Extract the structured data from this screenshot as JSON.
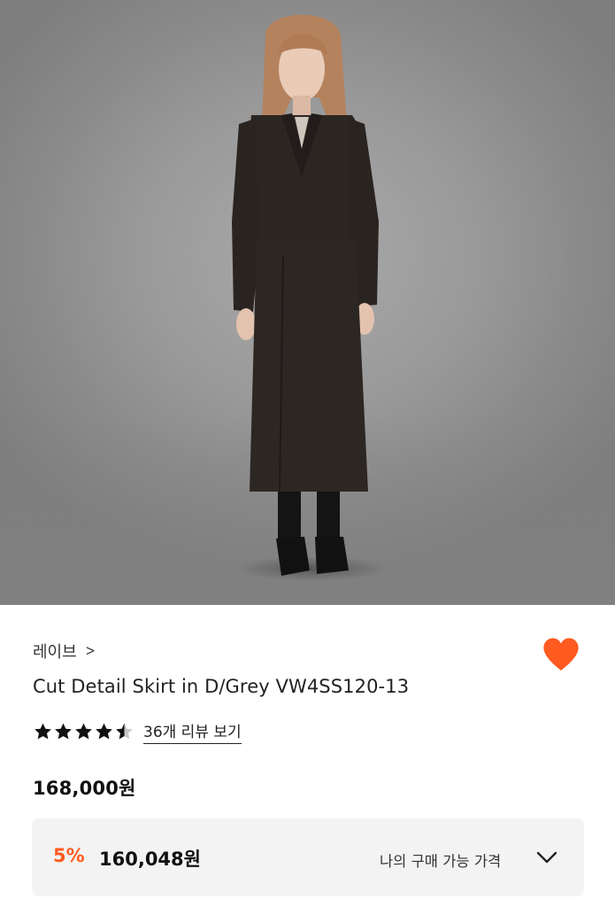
{
  "product": {
    "brand": "레이브",
    "brand_chevron": ">",
    "title": "Cut Detail Skirt in D/Grey VW4SS120-13",
    "rating": 4.5,
    "reviews_label": "36개 리뷰 보기",
    "price": "168,000원",
    "offer": {
      "discount": "5%",
      "sale_price": "160,048원",
      "label": "나의 구매 가능 가격"
    }
  },
  "colors": {
    "accent": "#ff5a1f",
    "heart": "#ff5a1f",
    "offer_bg": "#f3f3f3"
  },
  "icons": {
    "wishlist": "heart-icon",
    "rating": "star-icon",
    "expand": "chevron-down-icon"
  }
}
